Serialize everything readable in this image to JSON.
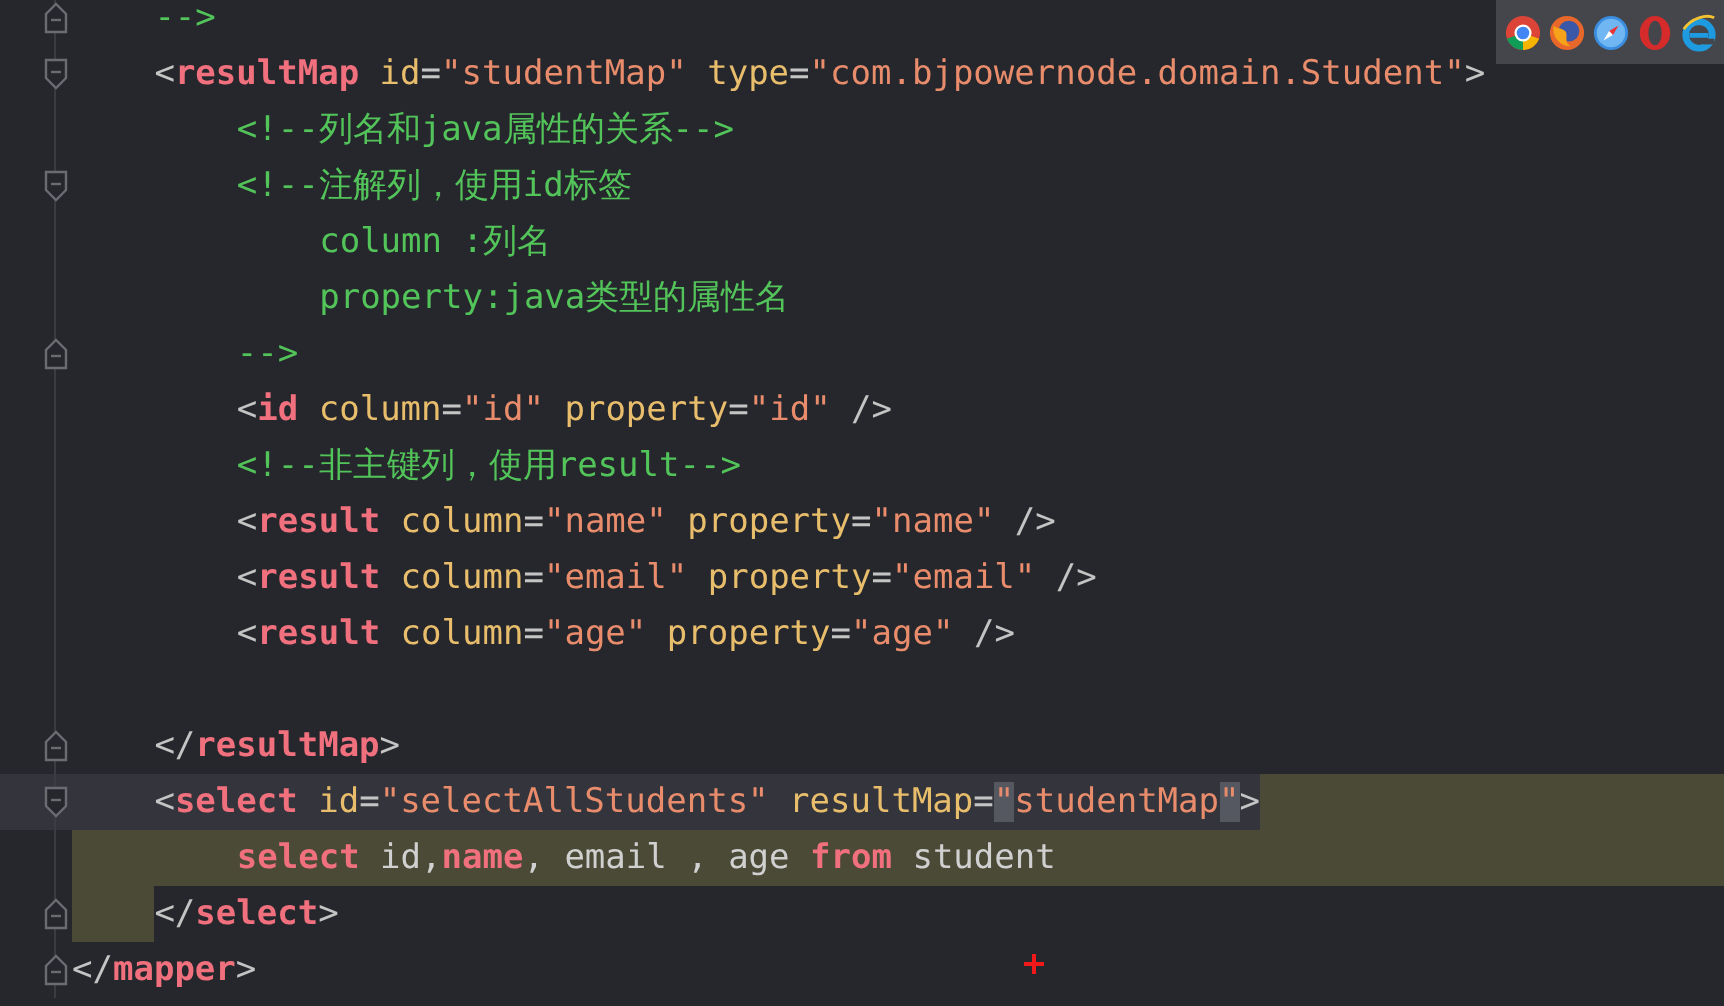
{
  "editor": {
    "lines": [
      {
        "children": [
          {
            "fold_start": false,
            "fold_end": true,
            "current": false,
            "injected_indent": false,
            "injected_tail": false,
            "tokens": [
              {
                "kind": "comment",
                "text": "-->"
              }
            ]
          },
          {
            "fold_start": true,
            "fold_end": false,
            "current": false,
            "injected_indent": false,
            "injected_tail": false,
            "tokens": [
              {
                "kind": "punct",
                "text": "<"
              },
              {
                "kind": "tag",
                "text": "resultMap"
              },
              {
                "kind": "attr",
                "text": " id"
              },
              {
                "kind": "punct",
                "text": "="
              },
              {
                "kind": "string",
                "text": "\"studentMap\""
              },
              {
                "kind": "attr",
                "text": " type"
              },
              {
                "kind": "punct",
                "text": "="
              },
              {
                "kind": "string",
                "text": "\"com.bjpowernode.domain.Student\""
              },
              {
                "kind": "punct",
                "text": ">"
              }
            ],
            "children": [
              {
                "fold_start": false,
                "fold_end": false,
                "current": false,
                "injected_indent": false,
                "injected_tail": false,
                "tokens": [
                  {
                    "kind": "comment",
                    "text": "<!--列名和java属性的关系-->"
                  }
                ]
              },
              {
                "fold_start": true,
                "fold_end": false,
                "current": false,
                "injected_indent": false,
                "injected_tail": false,
                "tokens": [
                  {
                    "kind": "comment",
                    "text": "<!--注解列，使用id标签"
                  }
                ],
                "children": [
                  {
                    "fold_start": false,
                    "fold_end": false,
                    "current": false,
                    "injected_indent": false,
                    "injected_tail": false,
                    "tokens": [
                      {
                        "kind": "comment",
                        "text": "column :列名"
                      }
                    ]
                  },
                  {
                    "fold_start": false,
                    "fold_end": false,
                    "current": false,
                    "injected_indent": false,
                    "injected_tail": false,
                    "tokens": [
                      {
                        "kind": "comment",
                        "text": "property:java类型的属性名"
                      }
                    ]
                  }
                ]
              },
              {
                "fold_start": false,
                "fold_end": true,
                "current": false,
                "injected_indent": false,
                "injected_tail": false,
                "tokens": [
                  {
                    "kind": "comment",
                    "text": "-->"
                  }
                ]
              },
              {
                "fold_start": false,
                "fold_end": false,
                "current": false,
                "injected_indent": false,
                "injected_tail": false,
                "tokens": [
                  {
                    "kind": "punct",
                    "text": "<"
                  },
                  {
                    "kind": "tag",
                    "text": "id"
                  },
                  {
                    "kind": "attr",
                    "text": " column"
                  },
                  {
                    "kind": "punct",
                    "text": "="
                  },
                  {
                    "kind": "string",
                    "text": "\"id\""
                  },
                  {
                    "kind": "attr",
                    "text": " property"
                  },
                  {
                    "kind": "punct",
                    "text": "="
                  },
                  {
                    "kind": "string",
                    "text": "\"id\""
                  },
                  {
                    "kind": "punct",
                    "text": " />"
                  }
                ]
              },
              {
                "fold_start": false,
                "fold_end": false,
                "current": false,
                "injected_indent": false,
                "injected_tail": false,
                "tokens": [
                  {
                    "kind": "comment",
                    "text": "<!--非主键列，使用result-->"
                  }
                ]
              },
              {
                "fold_start": false,
                "fold_end": false,
                "current": false,
                "injected_indent": false,
                "injected_tail": false,
                "tokens": [
                  {
                    "kind": "punct",
                    "text": "<"
                  },
                  {
                    "kind": "tag",
                    "text": "result"
                  },
                  {
                    "kind": "attr",
                    "text": " column"
                  },
                  {
                    "kind": "punct",
                    "text": "="
                  },
                  {
                    "kind": "string",
                    "text": "\"name\""
                  },
                  {
                    "kind": "attr",
                    "text": " property"
                  },
                  {
                    "kind": "punct",
                    "text": "="
                  },
                  {
                    "kind": "string",
                    "text": "\"name\""
                  },
                  {
                    "kind": "punct",
                    "text": " />"
                  }
                ]
              },
              {
                "fold_start": false,
                "fold_end": false,
                "current": false,
                "injected_indent": false,
                "injected_tail": false,
                "tokens": [
                  {
                    "kind": "punct",
                    "text": "<"
                  },
                  {
                    "kind": "tag",
                    "text": "result"
                  },
                  {
                    "kind": "attr",
                    "text": " column"
                  },
                  {
                    "kind": "punct",
                    "text": "="
                  },
                  {
                    "kind": "string",
                    "text": "\"email\""
                  },
                  {
                    "kind": "attr",
                    "text": " property"
                  },
                  {
                    "kind": "punct",
                    "text": "="
                  },
                  {
                    "kind": "string",
                    "text": "\"email\""
                  },
                  {
                    "kind": "punct",
                    "text": " />"
                  }
                ]
              },
              {
                "fold_start": false,
                "fold_end": false,
                "current": false,
                "injected_indent": false,
                "injected_tail": false,
                "tokens": [
                  {
                    "kind": "punct",
                    "text": "<"
                  },
                  {
                    "kind": "tag",
                    "text": "result"
                  },
                  {
                    "kind": "attr",
                    "text": " column"
                  },
                  {
                    "kind": "punct",
                    "text": "="
                  },
                  {
                    "kind": "string",
                    "text": "\"age\""
                  },
                  {
                    "kind": "attr",
                    "text": " property"
                  },
                  {
                    "kind": "punct",
                    "text": "="
                  },
                  {
                    "kind": "string",
                    "text": "\"age\""
                  },
                  {
                    "kind": "punct",
                    "text": " />"
                  }
                ]
              },
              {
                "fold_start": false,
                "fold_end": false,
                "current": false,
                "injected_indent": false,
                "injected_tail": false
              }
            ]
          },
          {
            "fold_start": false,
            "fold_end": true,
            "current": false,
            "injected_indent": false,
            "injected_tail": false,
            "tokens": [
              {
                "kind": "punct",
                "text": "</"
              },
              {
                "kind": "tag",
                "text": "resultMap"
              },
              {
                "kind": "punct",
                "text": ">"
              }
            ]
          },
          {
            "fold_start": true,
            "fold_end": false,
            "current": true,
            "injected_indent": false,
            "injected_tail": true,
            "tokens": [
              {
                "kind": "punct",
                "text": "<"
              },
              {
                "kind": "tag",
                "text": "select"
              },
              {
                "kind": "attr",
                "text": " id"
              },
              {
                "kind": "punct",
                "text": "="
              },
              {
                "kind": "string",
                "text": "\"selectAllStudents\""
              },
              {
                "kind": "attr",
                "text": " resultMap"
              },
              {
                "kind": "punct",
                "text": "="
              },
              {
                "kind": "match",
                "text": "\""
              },
              {
                "kind": "string",
                "text": "studentMap"
              },
              {
                "kind": "match",
                "text": "\""
              },
              {
                "kind": "punct",
                "text": ">"
              }
            ],
            "children": [
              {
                "fold_start": false,
                "fold_end": false,
                "current": false,
                "injected_indent": true,
                "injected_tail": true,
                "tokens": [
                  {
                    "kind": "sql_keyword",
                    "text": "select"
                  },
                  {
                    "kind": "sql",
                    "text": " id,"
                  },
                  {
                    "kind": "sql_keyword",
                    "text": "name"
                  },
                  {
                    "kind": "sql",
                    "text": ", email , age "
                  },
                  {
                    "kind": "sql_keyword",
                    "text": "from"
                  },
                  {
                    "kind": "sql",
                    "text": " student"
                  }
                ]
              }
            ]
          },
          {
            "fold_start": false,
            "fold_end": true,
            "current": false,
            "injected_indent": true,
            "injected_tail": false,
            "tokens": [
              {
                "kind": "punct",
                "text": "</"
              },
              {
                "kind": "tag",
                "text": "select"
              },
              {
                "kind": "punct",
                "text": ">"
              }
            ]
          }
        ]
      },
      {
        "fold_start": false,
        "fold_end": true,
        "current": false,
        "injected_indent": false,
        "injected_tail": false,
        "tokens": [
          {
            "kind": "punct",
            "text": "</"
          },
          {
            "kind": "tag",
            "text": "mapper"
          },
          {
            "kind": "punct",
            "text": ">"
          }
        ]
      }
    ]
  }
}
